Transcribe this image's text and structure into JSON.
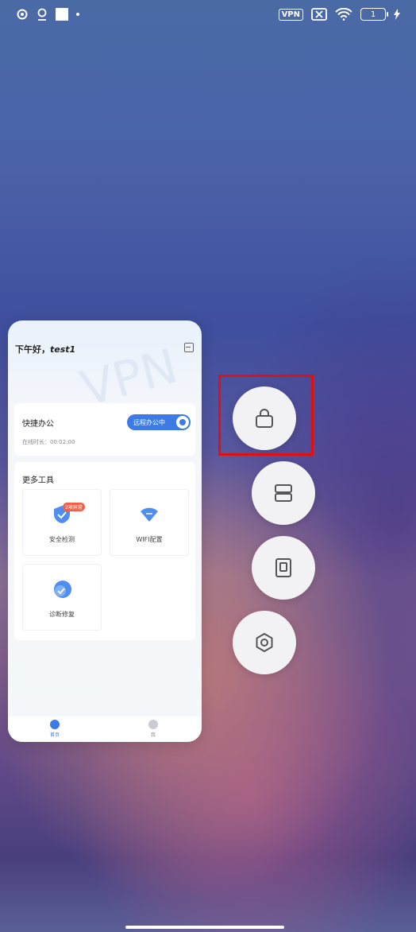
{
  "status_bar": {
    "vpn": "VPN",
    "battery": "1"
  },
  "app_card": {
    "greeting": "下午好，",
    "user": "test1",
    "quick_office": {
      "title": "快捷办公",
      "toggle_label": "远程办公中",
      "duration_label": "在线时长：",
      "duration": "00:02:00"
    },
    "tools": {
      "title": "更多工具",
      "items": [
        {
          "label": "安全检测",
          "badge": "2项异常"
        },
        {
          "label": "WIFI配置"
        },
        {
          "label": "诊断修复"
        }
      ]
    },
    "tabs": [
      {
        "label": "首页"
      },
      {
        "label": "我"
      }
    ]
  },
  "floating_actions": [
    {
      "icon": "lock-icon"
    },
    {
      "icon": "split-screen-icon"
    },
    {
      "icon": "floating-window-icon"
    },
    {
      "icon": "settings-icon"
    }
  ],
  "colors": {
    "accent": "#3c7be6",
    "highlight": "#e01010",
    "badge": "#f0604a"
  }
}
